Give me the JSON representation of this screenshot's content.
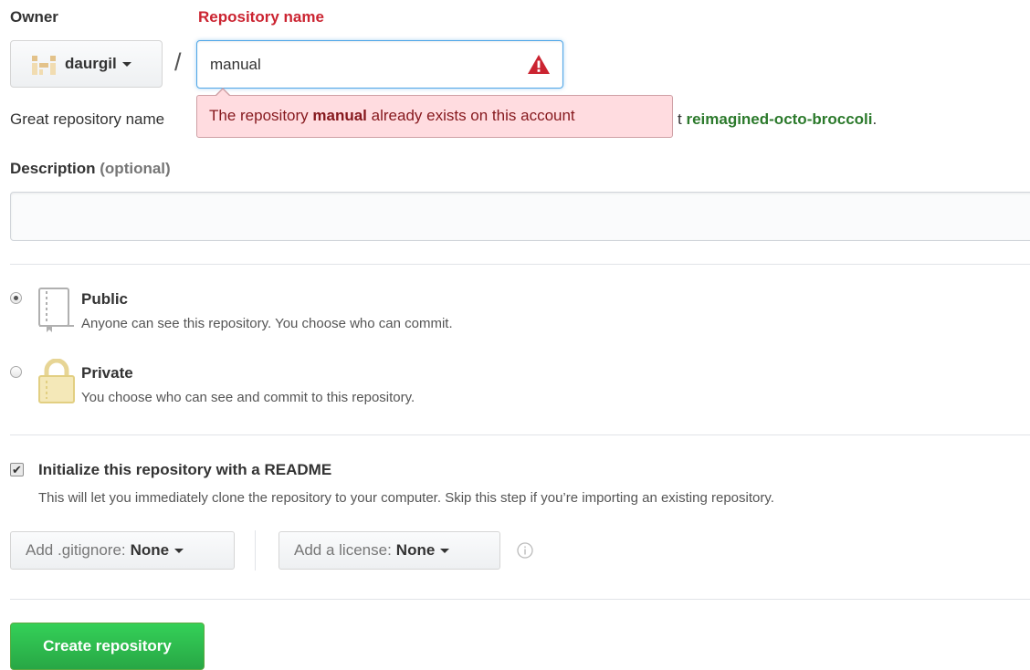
{
  "owner": {
    "label": "Owner",
    "name": "daurgil"
  },
  "repo": {
    "label": "Repository name",
    "value": "manual",
    "error_prefix": "The repository ",
    "error_name": "manual",
    "error_suffix": " already exists on this account"
  },
  "hint": {
    "prefix": "Great repository name",
    "suffix_start": "t ",
    "suggestion": "reimagined-octo-broccoli",
    "end": "."
  },
  "description": {
    "label": "Description",
    "optional": "(optional)",
    "value": ""
  },
  "visibility": {
    "public": {
      "title": "Public",
      "desc": "Anyone can see this repository. You choose who can commit.",
      "selected": true
    },
    "private": {
      "title": "Private",
      "desc": "You choose who can see and commit to this repository.",
      "selected": false
    }
  },
  "init": {
    "checked": true,
    "title": "Initialize this repository with a README",
    "desc": "This will let you immediately clone the repository to your computer. Skip this step if you’re importing an existing repository."
  },
  "gitignore": {
    "label": "Add .gitignore:",
    "value": "None"
  },
  "license": {
    "label": "Add a license:",
    "value": "None"
  },
  "create_label": "Create repository",
  "colors": {
    "error": "#cb2431",
    "accent_green": "#28a745",
    "focus_blue": "#51a7e8"
  }
}
